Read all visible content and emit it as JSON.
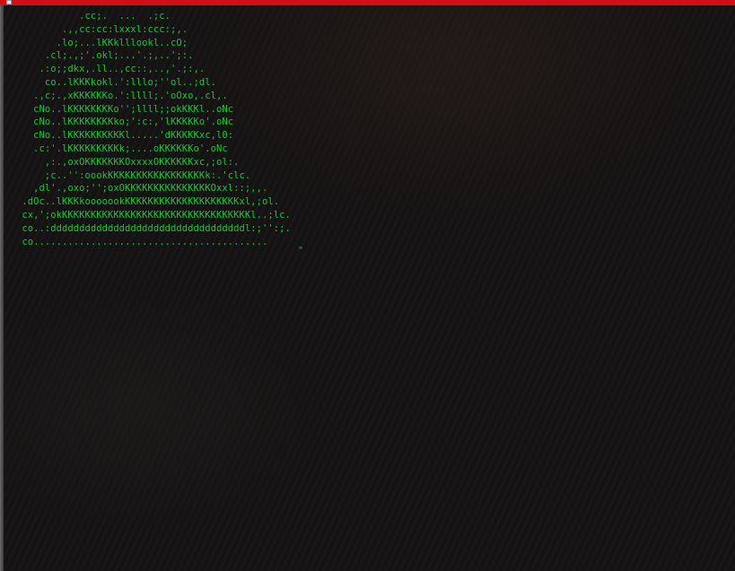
{
  "terminal": {
    "ascii_lines": [
      "           .cc;.  ...  .;c.",
      "        .,,cc:cc:lxxxl:ccc:;,.",
      "       .lo;...lKKklllookl..cO;",
      "     .cl;.,;'.okl;...'.;,..';:.",
      "    .:o;;dkx,.ll..,cc::,..,'.;:,.",
      "     co..lKKKkokl.':lllo;''ol..;dl.",
      "   .,c;.,xKKKKKKo.':llll;.'oOxo,.cl,.",
      "   cNo..lKKKKKKKKo'';llll;;okKKKl..oNc",
      "   cNo..lKKKKKKKKko;':c:,'lKKKKKo'.oNc",
      "   cNo..lKKKKKKKKKKl.....'dKKKKKxc,l0:",
      "   .c:'.lKKKKKKKKKk;....oKKKKKKo'.oNc",
      "     ,:.,oxOKKKKKKKOxxxxOKKKKKKxc,;ol:.",
      "     ;c..'':oookKKKKKKKKKKKKKKKKKk:.'clc.",
      "   ,dl'.,oxo;'';oxOKKKKKKKKKKKKKKKOxxl::;,,.",
      " .dOc..lKKKkooooookKKKKKKKKKKKKKKKKKKKKxl,;ol.",
      " cx,';okKKKKKKKKKKKKKKKKKKKKKKKKKKKKKKKKKl..;lc.",
      " co..:ddddddddddddddddddddddddddddddddddl:;'':;.",
      " co........................................."
    ],
    "trailing_mark": "\""
  }
}
